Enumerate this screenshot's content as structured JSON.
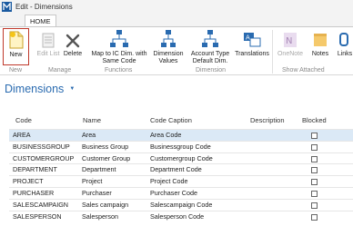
{
  "window": {
    "title": "Edit - Dimensions"
  },
  "ribbon": {
    "tab": "HOME",
    "buttons": {
      "new": "New",
      "edit_list": "Edit List",
      "delete": "Delete",
      "map_ic": "Map to IC Dim. with Same Code",
      "dimension_values": "Dimension Values",
      "account_type": "Account Type Default Dim.",
      "translations": "Translations",
      "onenote": "OneNote",
      "notes": "Notes",
      "links": "Links"
    },
    "groups": {
      "new": "New",
      "manage": "Manage",
      "functions": "Functions",
      "dimension": "Dimension",
      "show_attached": "Show Attached"
    }
  },
  "page": {
    "title": "Dimensions"
  },
  "table": {
    "headers": {
      "code": "Code",
      "name": "Name",
      "code_caption": "Code Caption",
      "description": "Description",
      "blocked": "Blocked"
    },
    "rows": [
      {
        "code": "AREA",
        "name": "Area",
        "code_caption": "Area Code",
        "description": "",
        "blocked": false
      },
      {
        "code": "BUSINESSGROUP",
        "name": "Business Group",
        "code_caption": "Businessgroup Code",
        "description": "",
        "blocked": false
      },
      {
        "code": "CUSTOMERGROUP",
        "name": "Customer Group",
        "code_caption": "Customergroup Code",
        "description": "",
        "blocked": false
      },
      {
        "code": "DEPARTMENT",
        "name": "Department",
        "code_caption": "Department Code",
        "description": "",
        "blocked": false
      },
      {
        "code": "PROJECT",
        "name": "Project",
        "code_caption": "Project Code",
        "description": "",
        "blocked": false
      },
      {
        "code": "PURCHASER",
        "name": "Purchaser",
        "code_caption": "Purchaser Code",
        "description": "",
        "blocked": false
      },
      {
        "code": "SALESCAMPAIGN",
        "name": "Sales campaign",
        "code_caption": "Salescampaign Code",
        "description": "",
        "blocked": false
      },
      {
        "code": "SALESPERSON",
        "name": "Salesperson",
        "code_caption": "Salesperson Code",
        "description": "",
        "blocked": false
      }
    ]
  },
  "colors": {
    "accent": "#2a6bb0",
    "selected_row": "#dbe9f6",
    "new_highlight": "#c0392b"
  }
}
